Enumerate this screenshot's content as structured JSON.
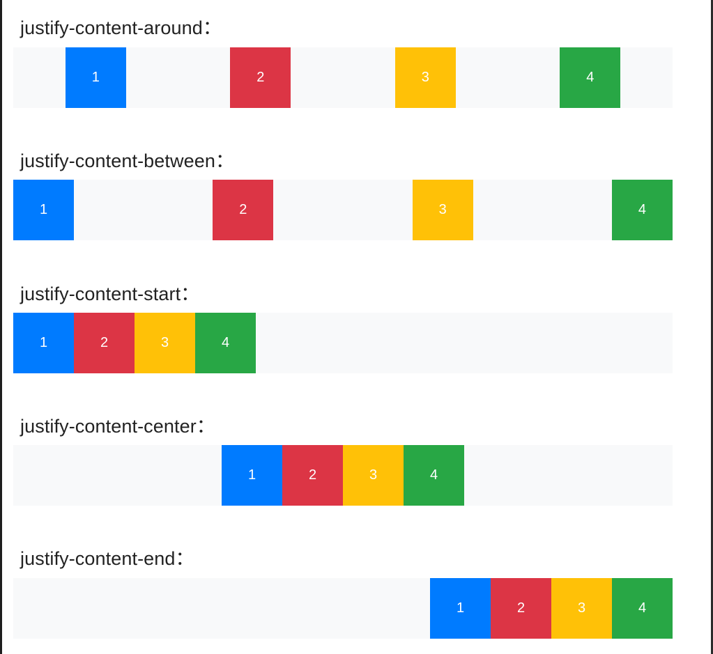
{
  "colors": {
    "item_1": "#007bff",
    "item_2": "#dc3545",
    "item_3": "#ffc107",
    "item_4": "#28a745",
    "track": "#f8f9fa"
  },
  "sections": [
    {
      "title": "justify-content-around：",
      "items": [
        "1",
        "2",
        "3",
        "4"
      ]
    },
    {
      "title": "justify-content-between：",
      "items": [
        "1",
        "2",
        "3",
        "4"
      ]
    },
    {
      "title": "justify-content-start：",
      "items": [
        "1",
        "2",
        "3",
        "4"
      ]
    },
    {
      "title": "justify-content-center：",
      "items": [
        "1",
        "2",
        "3",
        "4"
      ]
    },
    {
      "title": "justify-content-end：",
      "items": [
        "1",
        "2",
        "3",
        "4"
      ]
    }
  ]
}
